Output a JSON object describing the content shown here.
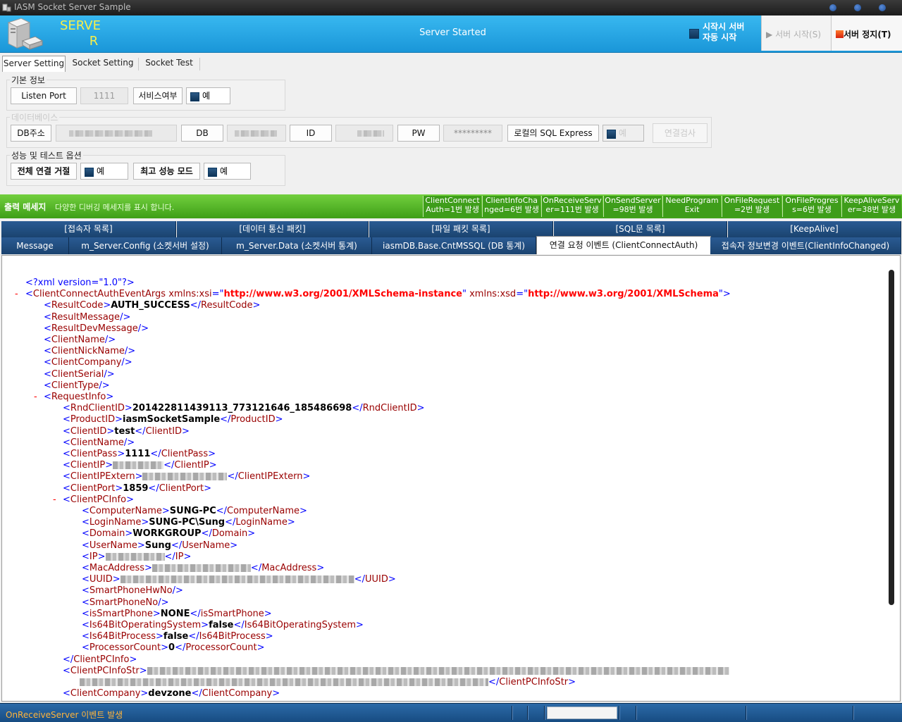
{
  "window": {
    "title": "IASM Socket Server Sample"
  },
  "header": {
    "logo_line1": "SERVE",
    "logo_line2": "R",
    "status": "Server Started",
    "auto_start_line1": "시작시 서버",
    "auto_start_line2": "자동 시작",
    "start_button": "서버 시작(S)",
    "stop_button": "서버 정지(T)"
  },
  "tabs": [
    "Server Setting",
    "Socket Setting",
    "Socket Test"
  ],
  "basic_info": {
    "title": "기본 정보",
    "listen_port_label": "Listen Port",
    "listen_port_value": "1111",
    "service_label": "서비스여부",
    "service_check": "예"
  },
  "database": {
    "title": "데이터베이스",
    "db_addr_label": "DB주소",
    "db_label": "DB",
    "id_label": "ID",
    "pw_label": "PW",
    "pw_value": "*********",
    "local_sql_label": "로컬의 SQL Express",
    "local_sql_check": "예",
    "test_button": "연결검사"
  },
  "performance": {
    "title": "성능 및 테스트 옵션",
    "reject_all_label": "전체 연결 거절",
    "reject_all_check": "예",
    "max_perf_label": "최고 성능 모드",
    "max_perf_check": "예"
  },
  "output": {
    "title": "출력 메세지",
    "description": "다양한 디버깅 메세지를 표시 합니다.",
    "counters": [
      {
        "l1": "ClientConnect",
        "l2": "Auth=1번 발생"
      },
      {
        "l1": "ClientInfoCha",
        "l2": "nged=6번 발생"
      },
      {
        "l1": "OnReceiveServ",
        "l2": "er=111번 발생"
      },
      {
        "l1": "OnSendServer",
        "l2": "=98번 발생"
      },
      {
        "l1": "NeedProgram",
        "l2": "Exit"
      },
      {
        "l1": "OnFileRequest",
        "l2": "=2번 발생"
      },
      {
        "l1": "OnFileProgres",
        "l2": "s=6번 발생"
      },
      {
        "l1": "KeepAliveServ",
        "l2": "er=38번 발생"
      }
    ]
  },
  "tabs_row1": [
    "[접속자 목록]",
    "[데이터 통신 패킷]",
    "[파일 패킷 목록]",
    "[SQL문 목록]",
    "[KeepAlive]"
  ],
  "tabs_row2": [
    "Message",
    "m_Server.Config (소켓서버 설정)",
    "m_Server.Data  (소켓서버 통계)",
    "iasmDB.Base.CntMSSQL  (DB 통계)",
    "연결 요청 이벤트 (ClientConnectAuth)",
    "접속자 정보변경 이벤트(ClientInfoChanged)"
  ],
  "xml": {
    "decl": "<?xml version=\"1.0\"?>",
    "minus": "-",
    "root_open": "ClientConnectAuthEventArgs",
    "attr1_name": "xmlns:xsi",
    "attr1_value": "http://www.w3.org/2001/XMLSchema-instance",
    "attr2_name": "xmlns:xsd",
    "attr2_value": "http://www.w3.org/2001/XMLSchema",
    "ResultCode": "AUTH_SUCCESS",
    "empty_top": [
      "ResultMessage",
      "ResultDevMessage",
      "ClientName",
      "ClientNickName",
      "ClientCompany",
      "ClientSerial",
      "ClientType"
    ],
    "RndClientID": "201422811439113_773121646_185486698",
    "ProductID": "iasmSocketSample",
    "ClientID": "test",
    "ClientPass": "1111",
    "ClientPort": "1859",
    "ComputerName": "SUNG-PC",
    "LoginName": "SUNG-PC\\Sung",
    "Domain": "WORKGROUP",
    "UserName": "Sung",
    "isSmartPhone": "NONE",
    "Is64BitOperatingSystem": "false",
    "Is64BitProcess": "false",
    "ProcessorCount": "0",
    "ClientCompany": "devzone"
  },
  "statusbar": {
    "text": "OnReceiveServer 이벤트 발생"
  }
}
